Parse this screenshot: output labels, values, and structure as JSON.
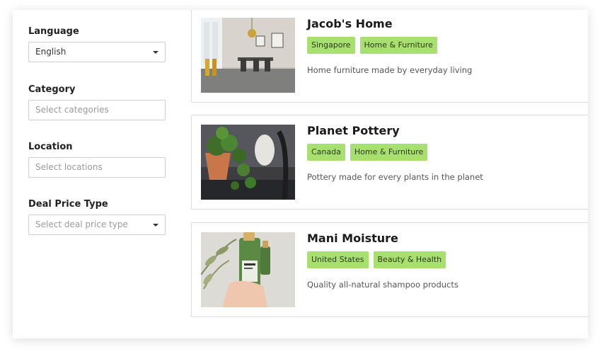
{
  "filters": {
    "language": {
      "label": "Language",
      "value": "English"
    },
    "category": {
      "label": "Category",
      "placeholder": "Select categories"
    },
    "location": {
      "label": "Location",
      "placeholder": "Select locations"
    },
    "deal_price_type": {
      "label": "Deal Price Type",
      "placeholder": "Select deal price type"
    }
  },
  "listings": [
    {
      "title": "Jacob's Home",
      "tags": [
        "Singapore",
        "Home & Furniture"
      ],
      "description": "Home furniture made by everyday living",
      "image": "dining-room-photo"
    },
    {
      "title": "Planet Pottery",
      "tags": [
        "Canada",
        "Home & Furniture"
      ],
      "description": "Pottery made for every plants in the planet",
      "image": "potted-plant-photo"
    },
    {
      "title": "Mani Moisture",
      "tags": [
        "United States",
        "Beauty & Health"
      ],
      "description": "Quality all-natural shampoo products",
      "image": "shampoo-bottles-photo"
    }
  ],
  "colors": {
    "tag_background": "#a8e06f",
    "card_border": "#dcdcdc"
  }
}
